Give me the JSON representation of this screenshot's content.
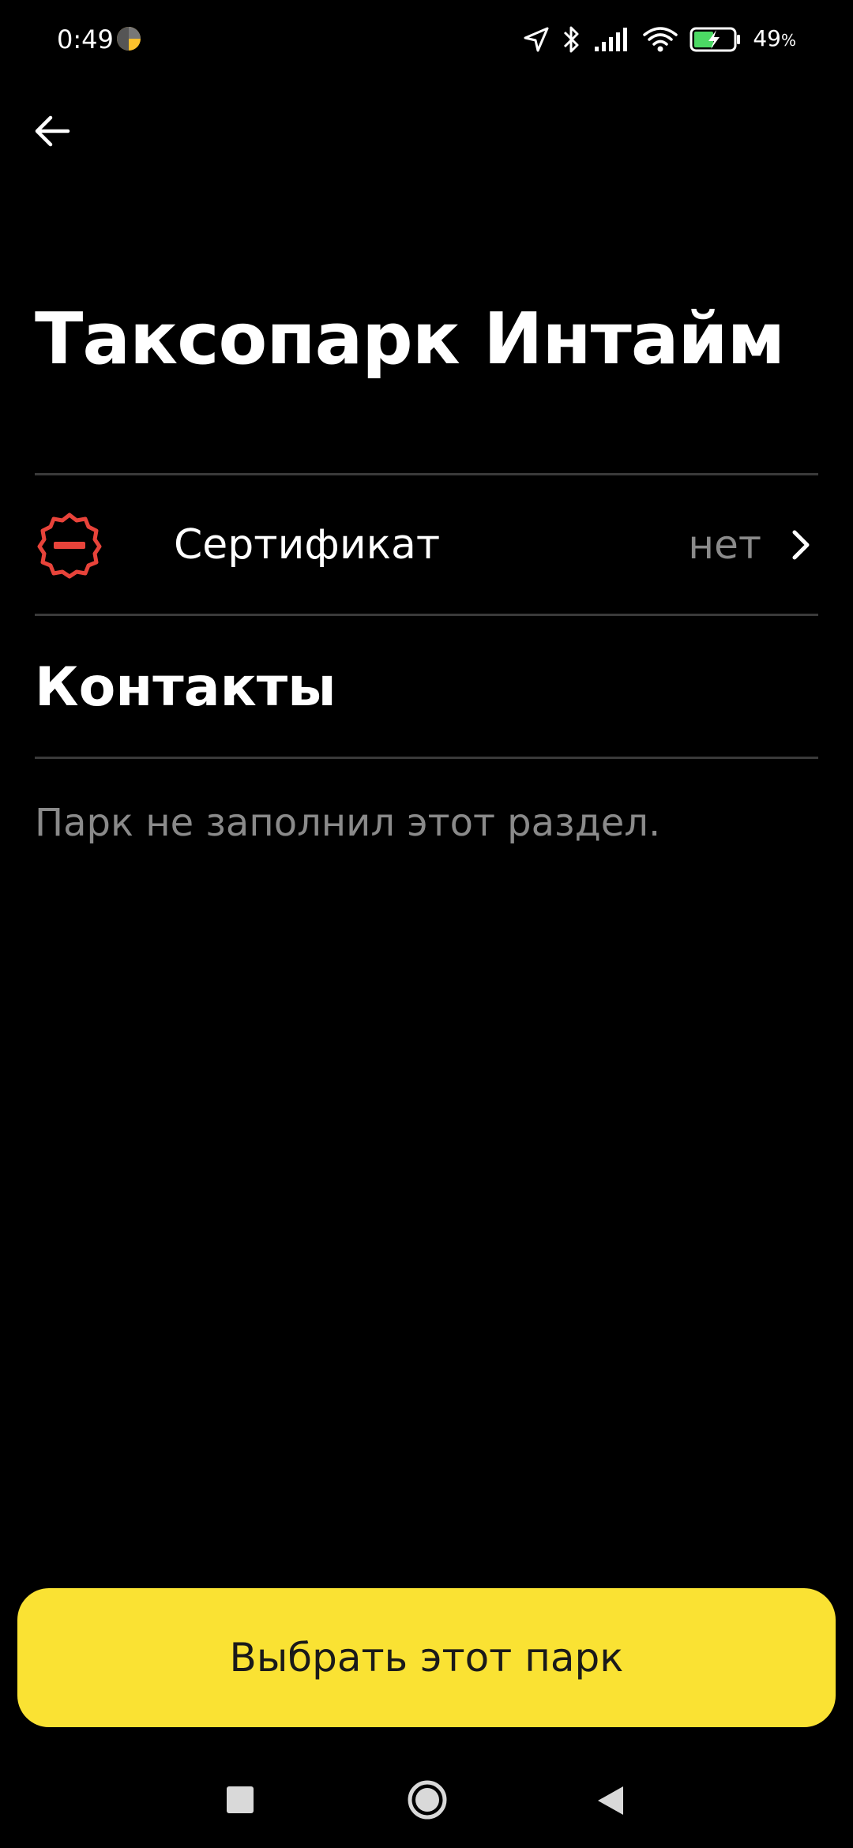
{
  "status_bar": {
    "time": "0:49",
    "battery_percent": "49",
    "battery_percent_sign": "%"
  },
  "header": {
    "title": "Таксопарк Интайм"
  },
  "certificate_row": {
    "label": "Сертификат",
    "value": "нет",
    "icon": "certificate-missing-icon",
    "icon_color": "#e8433a"
  },
  "contacts_section": {
    "heading": "Контакты",
    "empty_text": "Парк не заполнил этот раздел."
  },
  "primary_action": {
    "label": "Выбрать этот парк",
    "color": "#fae233"
  },
  "colors": {
    "background": "#000000",
    "text_primary": "#ffffff",
    "text_secondary": "#8a8a8a",
    "divider": "#3a3a3a"
  }
}
